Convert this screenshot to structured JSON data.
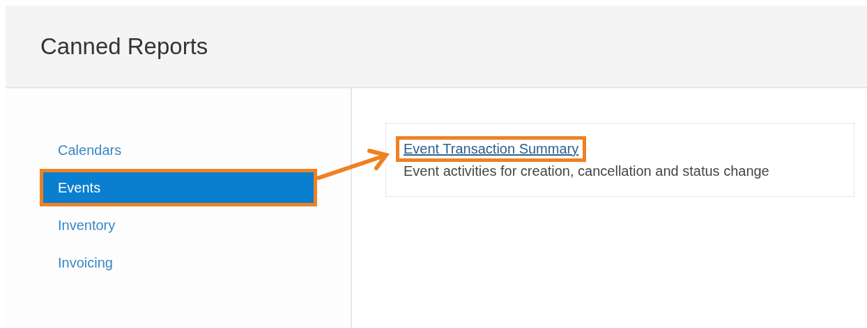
{
  "header": {
    "title": "Canned Reports"
  },
  "sidebar": {
    "items": [
      {
        "label": "Calendars",
        "selected": false,
        "highlighted": false
      },
      {
        "label": "Events",
        "selected": true,
        "highlighted": true
      },
      {
        "label": "Inventory",
        "selected": false,
        "highlighted": false
      },
      {
        "label": "Invoicing",
        "selected": false,
        "highlighted": false
      }
    ]
  },
  "reports": [
    {
      "title": "Event Transaction Summary",
      "description": "Event activities for creation, cancellation and status change",
      "highlighted": true
    }
  ]
}
